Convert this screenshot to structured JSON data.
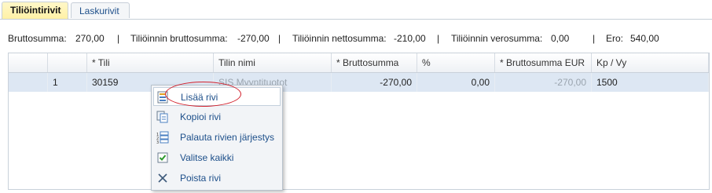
{
  "tabs": [
    {
      "label": "Tiliöintirivit",
      "active": true
    },
    {
      "label": "Laskurivit",
      "active": false
    }
  ],
  "summary": {
    "brutto_label": "Bruttosumma:",
    "brutto_value": "270,00",
    "sep": "|",
    "tiliointi_brutto_label": "Tiliöinnin bruttosumma:",
    "tiliointi_brutto_value": "-270,00",
    "tiliointi_netto_label": "Tiliöinnin nettosumma:",
    "tiliointi_netto_value": "-210,00",
    "tiliointi_vero_label": "Tiliöinnin verosumma:",
    "tiliointi_vero_value": "0,00",
    "ero_label": "Ero:",
    "ero_value": "540,00"
  },
  "grid": {
    "columns": [
      "",
      "",
      "* Tili",
      "Tilin nimi",
      "* Bruttosumma",
      "%",
      "* Bruttosumma EUR",
      "Kp / Vy"
    ],
    "rows": [
      {
        "num": "1",
        "tili": "30159",
        "tilin_nimi": "SIS Myyntituotot",
        "bruttosumma": "-270,00",
        "percent": "0,00",
        "bruttosumma_eur": "-270,00",
        "kp_vy": "1500"
      }
    ]
  },
  "context_menu": {
    "items": [
      {
        "label": "Lisää rivi",
        "icon": "add-row-icon"
      },
      {
        "label": "Kopioi rivi",
        "icon": "copy-row-icon"
      },
      {
        "label": "Palauta rivien järjestys",
        "icon": "reset-order-icon"
      },
      {
        "label": "Valitse kaikki",
        "icon": "select-all-icon"
      },
      {
        "label": "Poista rivi",
        "icon": "delete-row-icon"
      }
    ]
  },
  "colors": {
    "highlight_oval": "#d21f2b",
    "selected_row": "#dde7f3",
    "active_tab": "#fff1a6",
    "link": "#1d4f8a"
  }
}
